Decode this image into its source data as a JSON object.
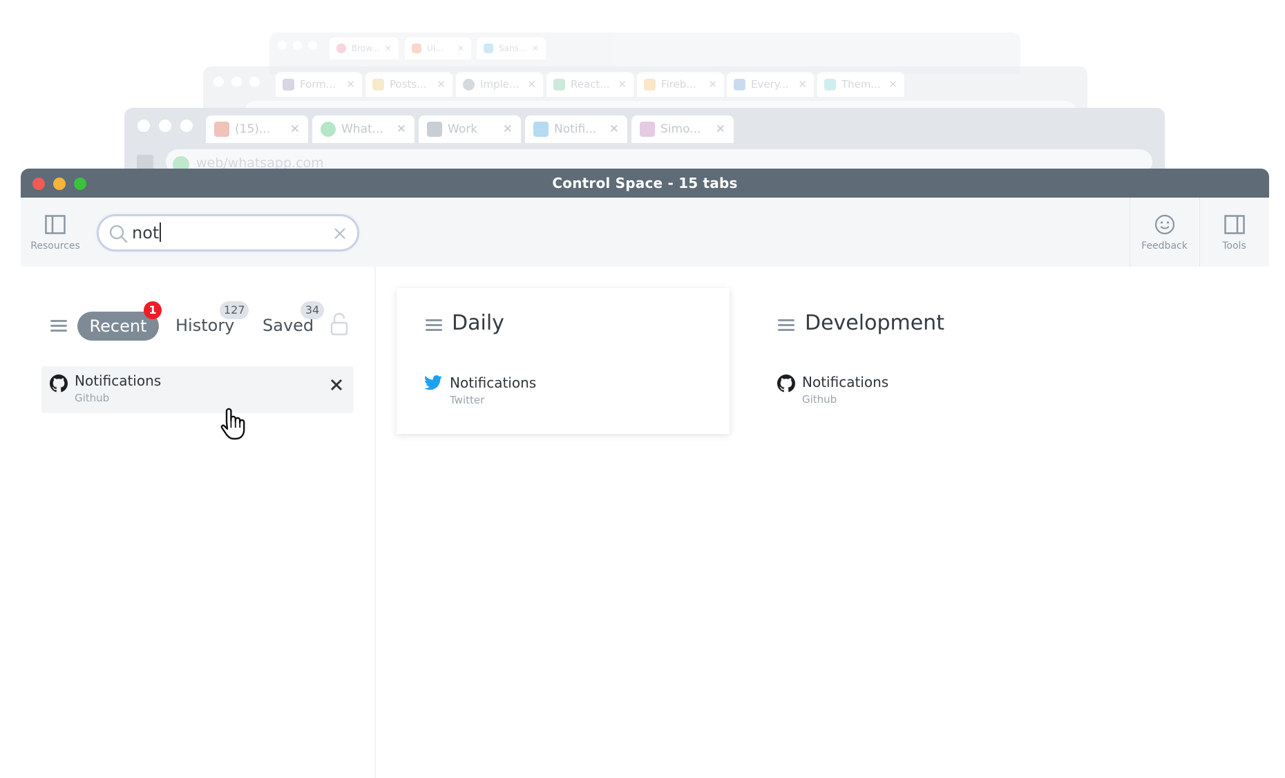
{
  "background_windows": {
    "win1_tabs": [
      {
        "label": "Brow...",
        "icon": "browser-icon"
      },
      {
        "label": "UI...",
        "icon": "figma-icon"
      },
      {
        "label": "Sans...",
        "icon": "sans-icon"
      }
    ],
    "win2_tabs": [
      {
        "label": "Form...",
        "icon": "bootstrap-icon"
      },
      {
        "label": "Posts...",
        "icon": "posts-icon"
      },
      {
        "label": "Imple...",
        "icon": "github-icon"
      },
      {
        "label": "React...",
        "icon": "vue-icon"
      },
      {
        "label": "Fireb...",
        "icon": "firebase-icon"
      },
      {
        "label": "Every...",
        "icon": "typescript-icon"
      },
      {
        "label": "Them...",
        "icon": "tailwind-icon"
      }
    ],
    "win3_tabs": [
      {
        "label": "(15)...",
        "icon": "gmail-icon"
      },
      {
        "label": "What...",
        "icon": "whatsapp-icon"
      },
      {
        "label": "Work",
        "icon": "work-icon"
      },
      {
        "label": "Notifi...",
        "icon": "twitter-icon"
      },
      {
        "label": "Simo...",
        "icon": "slack-icon"
      }
    ],
    "win3_address": "web/whatsapp.com"
  },
  "window": {
    "title": "Control Space - 15 tabs"
  },
  "toolbar": {
    "resources_label": "Resources",
    "feedback_label": "Feedback",
    "tools_label": "Tools"
  },
  "search": {
    "value": "not"
  },
  "sidebar": {
    "tabs": [
      {
        "label": "Recent",
        "badge": "1",
        "active": true
      },
      {
        "label": "History",
        "badge": "127"
      },
      {
        "label": "Saved",
        "badge": "34"
      }
    ],
    "results": [
      {
        "title": "Notifications",
        "subtitle": "Github",
        "icon": "github-icon"
      }
    ]
  },
  "collections": [
    {
      "name": "Daily",
      "items": [
        {
          "title": "Notifications",
          "subtitle": "Twitter",
          "icon": "twitter-icon"
        }
      ]
    },
    {
      "name": "Development",
      "items": [
        {
          "title": "Notifications",
          "subtitle": "Github",
          "icon": "github-icon"
        }
      ]
    }
  ],
  "colors": {
    "titlebar": "#5f6b76",
    "close": "#f25a54",
    "minimize": "#f6b43a",
    "maximize": "#3ac13e",
    "active_tab_pill": "#7e8b97",
    "notification_badge": "#ee1c25",
    "twitter": "#1da1f2"
  }
}
